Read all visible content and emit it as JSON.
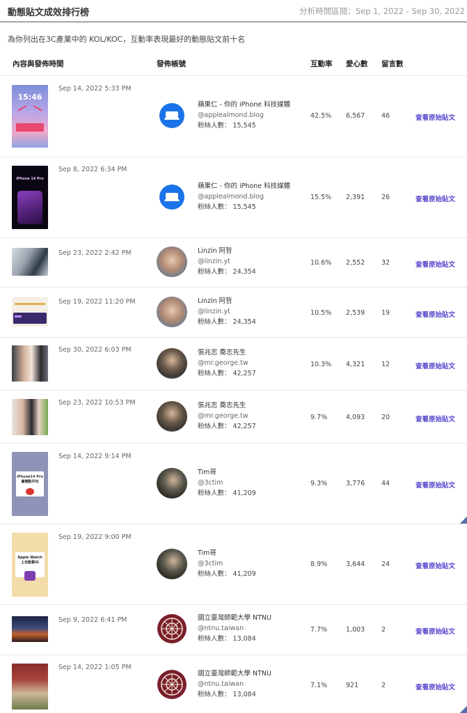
{
  "header": {
    "title": "動態貼文成效排行榜",
    "range_label": "分析時間區間：Sep 1, 2022 - Sep 30, 2022"
  },
  "subtitle": "為你列出在3C產業中的 KOL/KOC，互動率表現最好的動態貼文前十名",
  "columns": {
    "content": "內容與發佈時間",
    "account": "發佈帳號",
    "engagement": "互動率",
    "likes": "愛心數",
    "comments": "留言數"
  },
  "rows": [
    {
      "date": "Sep 14, 2022 5:33 PM",
      "name": "蘋果仁 - 你的 iPhone 科技媒體",
      "handle": "@applealmond.blog",
      "fans": "粉絲人數： 15,545",
      "rate": "42.5%",
      "likes": "6,567",
      "comments": "46",
      "link": "查看原始貼文",
      "thumb_text": "15:46"
    },
    {
      "date": "Sep 8, 2022 6:34 PM",
      "name": "蘋果仁 - 你的 iPhone 科技媒體",
      "handle": "@applealmond.blog",
      "fans": "粉絲人數： 15,545",
      "rate": "15.5%",
      "likes": "2,391",
      "comments": "26",
      "link": "查看原始貼文",
      "thumb_text": "iPhone 14 Pro"
    },
    {
      "date": "Sep 23, 2022 2:42 PM",
      "name": "Linzin 阿哲",
      "handle": "@linzin.yt",
      "fans": "粉絲人數： 24,354",
      "rate": "10.6%",
      "likes": "2,552",
      "comments": "32",
      "link": "查看原始貼文",
      "thumb_text": ""
    },
    {
      "date": "Sep 19, 2022 11:20 PM",
      "name": "Linzin 阿哲",
      "handle": "@linzin.yt",
      "fans": "粉絲人數： 24,354",
      "rate": "10.5%",
      "likes": "2,539",
      "comments": "19",
      "link": "查看原始貼文",
      "thumb_text": ""
    },
    {
      "date": "Sep 30, 2022 6:03 PM",
      "name": "張兆志 喬志先生",
      "handle": "@mr.george.tw",
      "fans": "粉絲人數： 42,257",
      "rate": "10.3%",
      "likes": "4,321",
      "comments": "12",
      "link": "查看原始貼文",
      "thumb_text": ""
    },
    {
      "date": "Sep 23, 2022 10:53 PM",
      "name": "張兆志 喬志先生",
      "handle": "@mr.george.tw",
      "fans": "粉絲人數： 42,257",
      "rate": "9.7%",
      "likes": "4,093",
      "comments": "20",
      "link": "查看原始貼文",
      "thumb_text": ""
    },
    {
      "date": "Sep 14, 2022 9:14 PM",
      "name": "Tim哥",
      "handle": "@3ctim",
      "fans": "粉絲人數： 41,209",
      "rate": "9.3%",
      "likes": "3,776",
      "comments": "44",
      "link": "查看原始貼文",
      "thumb_text": "iPhone14 Pro 實機動手玩"
    },
    {
      "date": "Sep 19, 2022 9:00 PM",
      "name": "Tim哥",
      "handle": "@3ctim",
      "fans": "粉絲人數： 41,209",
      "rate": "8.9%",
      "likes": "3,644",
      "comments": "24",
      "link": "查看原始貼文",
      "thumb_text": "Apple Watch 上也能看IG"
    },
    {
      "date": "Sep 9, 2022 6:41 PM",
      "name": "國立臺灣師範大學 NTNU",
      "handle": "@ntnu.taiwan",
      "fans": "粉絲人數： 13,084",
      "rate": "7.7%",
      "likes": "1,003",
      "comments": "2",
      "link": "查看原始貼文",
      "thumb_text": ""
    },
    {
      "date": "Sep 14, 2022 1:05 PM",
      "name": "國立臺灣師範大學 NTNU",
      "handle": "@ntnu.taiwan",
      "fans": "粉絲人數： 13,084",
      "rate": "7.1%",
      "likes": "921",
      "comments": "2",
      "link": "查看原始貼文",
      "thumb_text": ""
    }
  ]
}
